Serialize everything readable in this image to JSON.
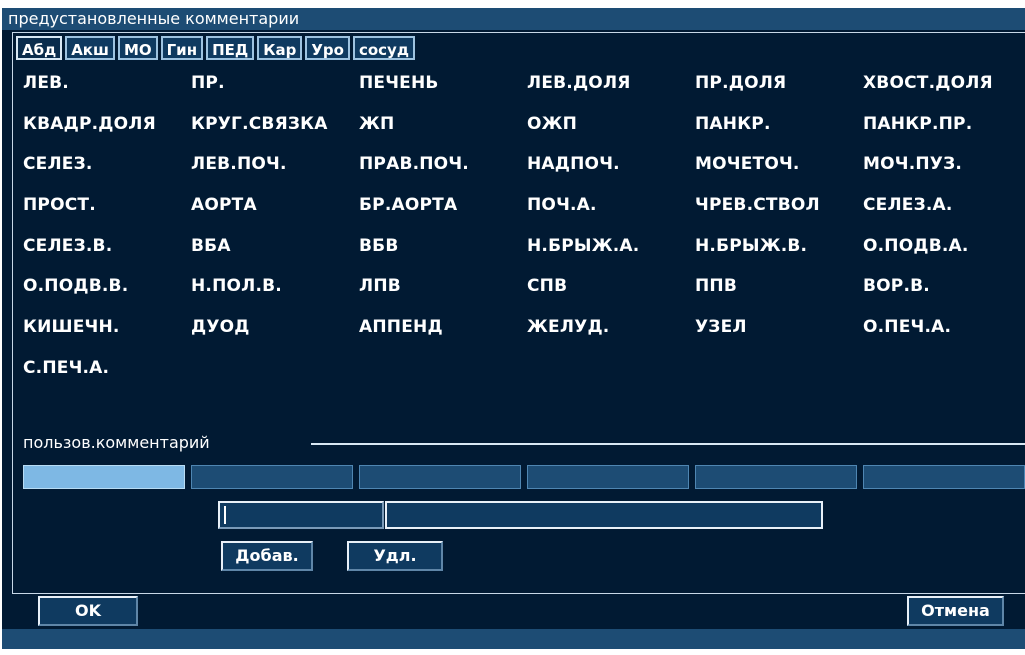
{
  "dialog": {
    "title": "предустановленные комментарии"
  },
  "tabs": [
    "Абд",
    "Акш",
    "МО",
    "Гин",
    "ПЕД",
    "Кар",
    "Уро",
    "сосуд"
  ],
  "comments": [
    [
      "ЛЕВ.",
      "ПР.",
      "ПЕЧЕНЬ",
      "ЛЕВ.ДОЛЯ",
      "ПР.ДОЛЯ",
      "ХВОСТ.ДОЛЯ"
    ],
    [
      "КВАДР.ДОЛЯ",
      "КРУГ.СВЯЗКА",
      "ЖП",
      "ОЖП",
      "ПАНКР.",
      "ПАНКР.ПР."
    ],
    [
      "СЕЛЕЗ.",
      "ЛЕВ.ПОЧ.",
      "ПРАВ.ПОЧ.",
      "НАДПОЧ.",
      "МОЧЕТОЧ.",
      "МОЧ.ПУЗ."
    ],
    [
      "ПРОСТ.",
      "АОРТА",
      "БР.АОРТА",
      "ПОЧ.А.",
      "ЧРЕВ.СТВОЛ",
      "СЕЛЕЗ.А."
    ],
    [
      "СЕЛЕЗ.В.",
      "ВБА",
      "ВБВ",
      "Н.БРЫЖ.А.",
      "Н.БРЫЖ.В.",
      "О.ПОДВ.А."
    ],
    [
      "О.ПОДВ.В.",
      "Н.ПОЛ.В.",
      "ЛПВ",
      "СПВ",
      "ППВ",
      "ВОР.В."
    ],
    [
      "КИШЕЧН.",
      "ДУОД",
      "АППЕНД",
      "ЖЕЛУД.",
      "УЗЕЛ",
      "О.ПЕЧ.А."
    ],
    [
      "С.ПЕЧ.А."
    ]
  ],
  "custom": {
    "label": "пользов.комментарий",
    "slots": [
      "",
      "",
      "",
      "",
      "",
      ""
    ],
    "input_short": "",
    "input_long": ""
  },
  "buttons": {
    "add": "Добав.",
    "delete": "Удл.",
    "ok": "OK",
    "cancel": "Отмена"
  },
  "colors": {
    "background": "#011a33",
    "bar": "#1d4c74",
    "selected_slot": "#7eb8e4"
  }
}
